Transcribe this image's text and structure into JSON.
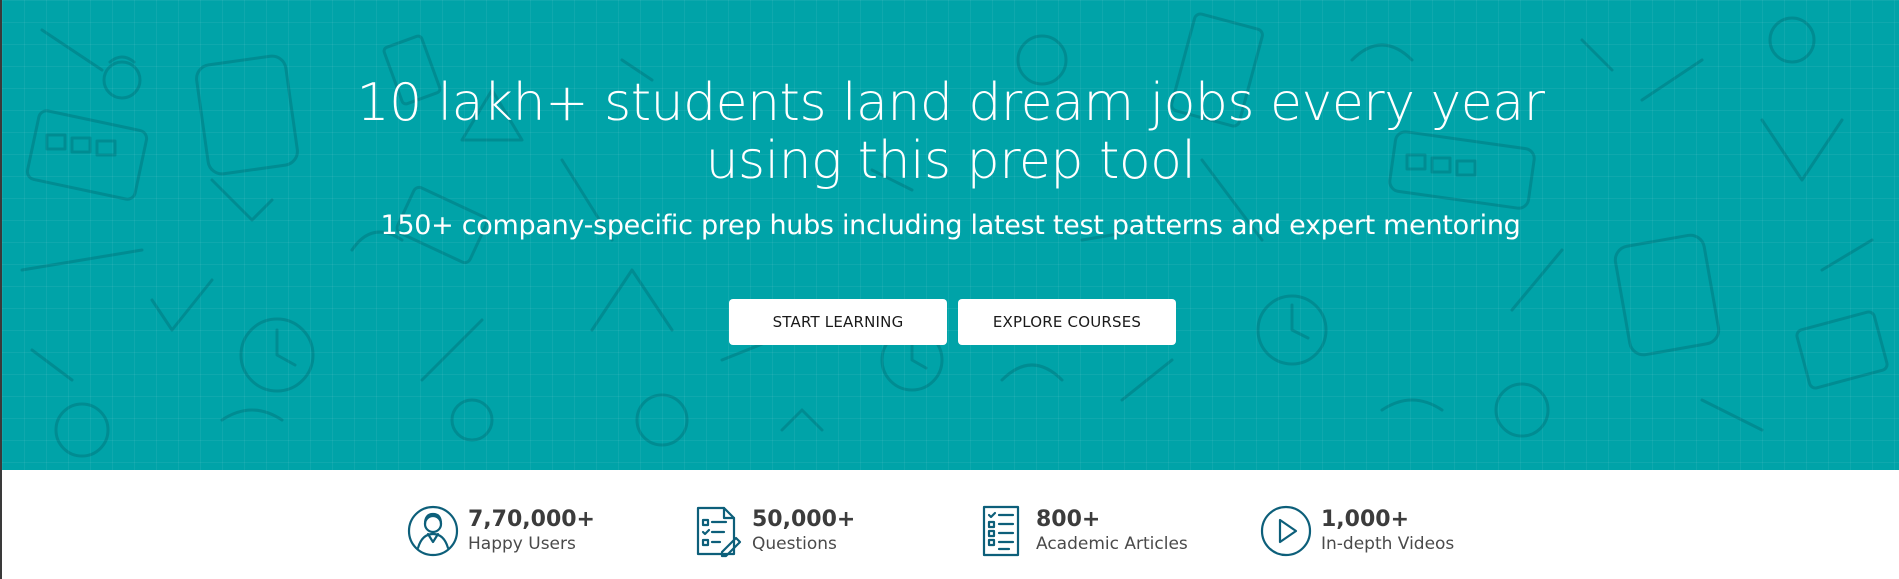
{
  "hero": {
    "title_line1": "10 lakh+ students land dream jobs every year",
    "title_line2": "using this prep tool",
    "subtitle": "150+ company-specific prep hubs including latest test patterns and expert mentoring",
    "start_button": "START LEARNING",
    "explore_button": "EXPLORE COURSES",
    "background_color": "#00a3a8"
  },
  "stats": [
    {
      "value": "7,70,000+",
      "label": "Happy Users",
      "icon": "user-icon"
    },
    {
      "value": "50,000+",
      "label": "Questions",
      "icon": "question-sheet-icon"
    },
    {
      "value": "800+",
      "label": "Academic Articles",
      "icon": "article-icon"
    },
    {
      "value": "1,000+",
      "label": "In-depth Videos",
      "icon": "play-icon"
    }
  ],
  "colors": {
    "icon_stroke": "#0d5f7a",
    "stat_text": "#3c3c3c"
  }
}
